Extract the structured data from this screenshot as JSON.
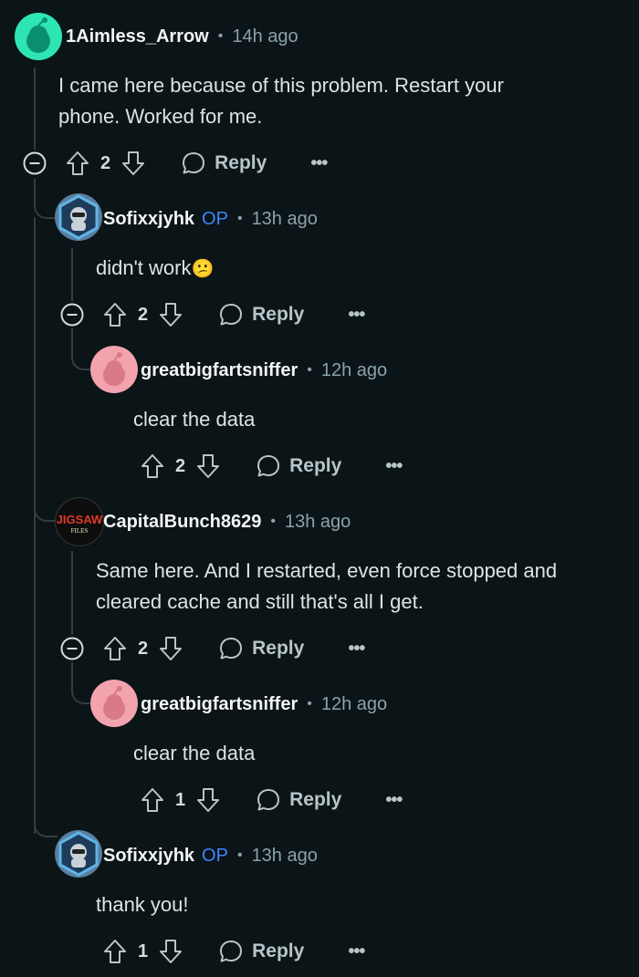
{
  "icons": {
    "upvote": "arrow-up-icon",
    "downvote": "arrow-down-icon",
    "reply": "speech-bubble-icon",
    "more": "ellipsis-icon",
    "collapse": "minus-circle-icon"
  },
  "colors": {
    "background": "#0b1416",
    "op_badge": "#3d87ff",
    "thread_line": "#333d42",
    "teal_avatar": "#2ee6b4",
    "pink_avatar": "#f3a3ad"
  },
  "comments": [
    {
      "username": "1Aimless_Arrow",
      "op": "",
      "separator": "•",
      "time": "14h ago",
      "lines": [
        "I came here because of this problem. Restart your",
        "phone. Worked for me."
      ],
      "votes": "2",
      "reply_label": "Reply",
      "more_label": "•••"
    },
    {
      "username": "Sofixxjyhk",
      "op": "OP",
      "separator": "•",
      "time": "13h ago",
      "lines": [
        "didn't work"
      ],
      "emoji": "😕",
      "votes": "2",
      "reply_label": "Reply",
      "more_label": "•••"
    },
    {
      "username": "greatbigfartsniffer",
      "op": "",
      "separator": "•",
      "time": "12h ago",
      "lines": [
        "clear the data"
      ],
      "votes": "2",
      "reply_label": "Reply",
      "more_label": "•••"
    },
    {
      "username": "CapitalBunch8629",
      "op": "",
      "separator": "•",
      "time": "13h ago",
      "avatar_text": "JIGSAW",
      "avatar_subtext": "FILES",
      "lines": [
        "Same here. And I restarted, even force stopped and",
        "cleared cache and still that's all I get."
      ],
      "votes": "2",
      "reply_label": "Reply",
      "more_label": "•••"
    },
    {
      "username": "greatbigfartsniffer",
      "op": "",
      "separator": "•",
      "time": "12h ago",
      "lines": [
        "clear the data"
      ],
      "votes": "1",
      "reply_label": "Reply",
      "more_label": "•••"
    },
    {
      "username": "Sofixxjyhk",
      "op": "OP",
      "separator": "•",
      "time": "13h ago",
      "lines": [
        "thank you!"
      ],
      "votes": "1",
      "reply_label": "Reply",
      "more_label": "•••"
    }
  ]
}
